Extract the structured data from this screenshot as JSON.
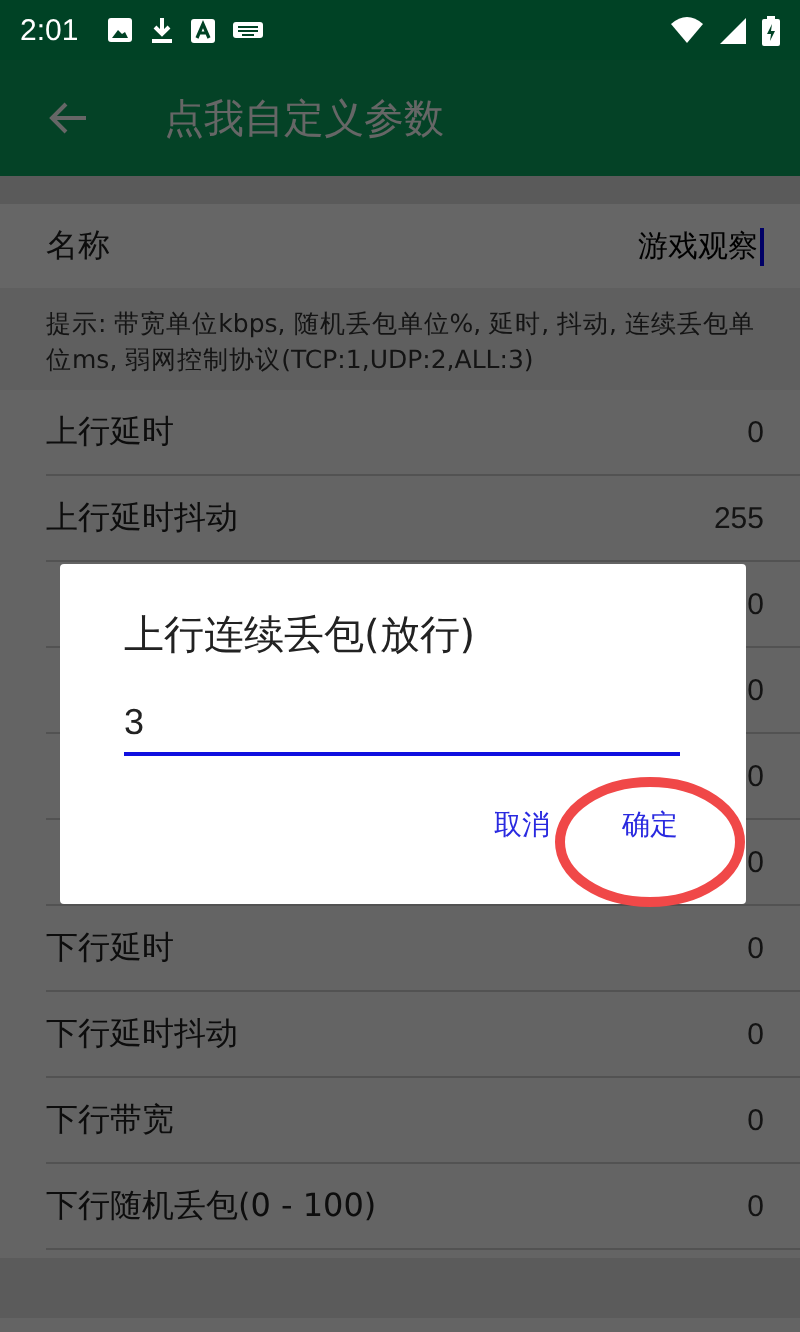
{
  "status_bar": {
    "time": "2:01"
  },
  "app_bar": {
    "title": "点我自定义参数"
  },
  "name_field": {
    "label": "名称",
    "value": "游戏观察"
  },
  "hint": "提示: 带宽单位kbps, 随机丢包单位%, 延时, 抖动, 连续丢包单位ms, 弱网控制协议(TCP:1,UDP:2,ALL:3)",
  "settings": [
    {
      "label": "上行延时",
      "value": "0"
    },
    {
      "label": "上行延时抖动",
      "value": "255"
    },
    {
      "value": "0"
    },
    {
      "value": "0"
    },
    {
      "value": "0"
    },
    {
      "value": "0"
    },
    {
      "label": "下行延时",
      "value": "0"
    },
    {
      "label": "下行延时抖动",
      "value": "0"
    },
    {
      "label": "下行带宽",
      "value": "0"
    },
    {
      "label": "下行随机丢包(0 - 100)",
      "value": "0"
    }
  ],
  "dialog": {
    "title": "上行连续丢包(放行)",
    "value": "3",
    "buttons": [
      "取消",
      "确定"
    ]
  }
}
